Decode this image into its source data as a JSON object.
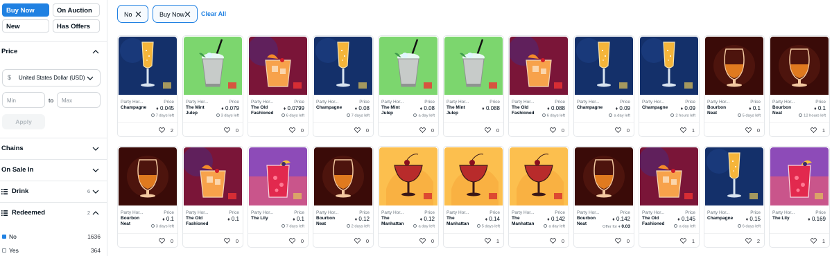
{
  "status": {
    "buy_now": "Buy Now",
    "on_auction": "On Auction",
    "new": "New",
    "has_offers": "Has Offers"
  },
  "price": {
    "title": "Price",
    "currency_symbol": "$",
    "currency": "United States Dollar (USD)",
    "min_placeholder": "Min",
    "max_placeholder": "Max",
    "to": "to",
    "apply": "Apply"
  },
  "sections": {
    "chains": "Chains",
    "on_sale_in": "On Sale In",
    "drink": "Drink",
    "drink_count": "6",
    "redeemed": "Redeemed",
    "redeemed_count": "2"
  },
  "redeemed_options": [
    {
      "label": "No",
      "count": "1636",
      "checked": true
    },
    {
      "label": "Yes",
      "count": "364",
      "checked": false
    }
  ],
  "chips": [
    {
      "label": "No"
    },
    {
      "label": "Buy Now"
    }
  ],
  "clear_all": "Clear All",
  "card_labels": {
    "collection": "Party Hor...",
    "price": "Price",
    "offer_prefix": "Offer for"
  },
  "cards": [
    {
      "drink": "champagne",
      "name": [
        "Champagne"
      ],
      "price": "0.045",
      "time": "7 days left",
      "likes": "2"
    },
    {
      "drink": "julep",
      "name": [
        "The Mint",
        "Julep"
      ],
      "price": "0.079",
      "time": "3 days left",
      "likes": "0"
    },
    {
      "drink": "oldfashioned",
      "name": [
        "The Old",
        "Fashioned"
      ],
      "price": "0.0799",
      "time": "6 days left",
      "likes": "0"
    },
    {
      "drink": "champagne",
      "name": [
        "Champagne"
      ],
      "price": "0.08",
      "time": "7 days left",
      "likes": "0"
    },
    {
      "drink": "julep",
      "name": [
        "The Mint",
        "Julep"
      ],
      "price": "0.08",
      "time": "a day left",
      "likes": "0"
    },
    {
      "drink": "julep",
      "name": [
        "The Mint",
        "Julep"
      ],
      "price": "0.088",
      "time": "",
      "likes": "0"
    },
    {
      "drink": "oldfashioned",
      "name": [
        "The Old",
        "Fashioned"
      ],
      "price": "0.088",
      "time": "6 days left",
      "likes": "0"
    },
    {
      "drink": "champagne",
      "name": [
        "Champagne"
      ],
      "price": "0.09",
      "time": "a day left",
      "likes": "0"
    },
    {
      "drink": "champagne",
      "name": [
        "Champagne"
      ],
      "price": "0.09",
      "time": "2 hours left",
      "likes": "1"
    },
    {
      "drink": "bourbon",
      "name": [
        "Bourbon",
        "Neat"
      ],
      "price": "0.1",
      "time": "5 days left",
      "likes": "0"
    },
    {
      "drink": "bourbon",
      "name": [
        "Bourbon",
        "Neat"
      ],
      "price": "0.1",
      "time": "12 hours left",
      "likes": "1"
    },
    {
      "drink": "bourbon",
      "name": [
        "Bourbon",
        "Neat"
      ],
      "price": "0.1",
      "time": "3 days left",
      "likes": "0"
    },
    {
      "drink": "oldfashioned",
      "name": [
        "The Old",
        "Fashioned"
      ],
      "price": "0.1",
      "time": "",
      "likes": "0"
    },
    {
      "drink": "lily",
      "name": [
        "The Lily"
      ],
      "price": "0.1",
      "time": "7 days left",
      "likes": "0"
    },
    {
      "drink": "bourbon",
      "name": [
        "Bourbon",
        "Neat"
      ],
      "price": "0.12",
      "time": "2 days left",
      "likes": "0"
    },
    {
      "drink": "manhattan",
      "name": [
        "The",
        "Manhattan"
      ],
      "price": "0.12",
      "time": "a day left",
      "likes": "0"
    },
    {
      "drink": "manhattan",
      "name": [
        "The",
        "Manhattan"
      ],
      "price": "0.14",
      "time": "5 days left",
      "likes": "1"
    },
    {
      "drink": "manhattan",
      "name": [
        "The",
        "Manhattan"
      ],
      "price": "0.142",
      "time": "a day left",
      "likes": "0"
    },
    {
      "drink": "bourbon",
      "name": [
        "Bourbon",
        "Neat"
      ],
      "price": "0.142",
      "time": "",
      "offer": "0.03",
      "likes": "0"
    },
    {
      "drink": "oldfashioned",
      "name": [
        "The Old",
        "Fashioned"
      ],
      "price": "0.145",
      "time": "a day left",
      "likes": "1"
    },
    {
      "drink": "champagne",
      "name": [
        "Champagne"
      ],
      "price": "0.15",
      "time": "6 days left",
      "likes": "2"
    },
    {
      "drink": "lily",
      "name": [
        "The Lily"
      ],
      "price": "0.169",
      "time": "",
      "likes": "1"
    }
  ],
  "colors": {
    "accent": "#2081e2",
    "champagne_bg": "#14306a",
    "julep_bg": "#7cd66e",
    "oldfashioned_bg": "#7a1538",
    "bourbon_bg": "#3a0b08",
    "manhattan_bg": "#fcbf4e",
    "lily_bg": "#8d4bb8"
  }
}
